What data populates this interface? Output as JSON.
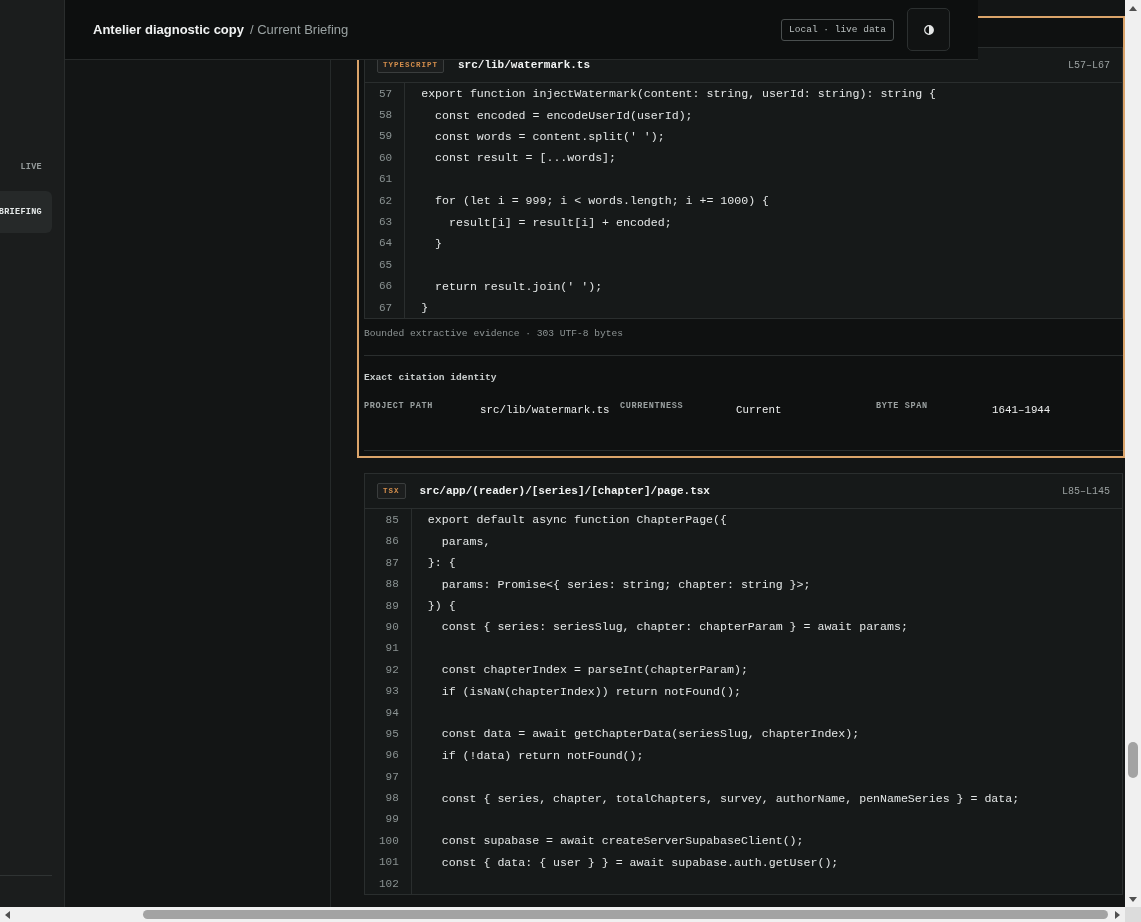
{
  "sidebar": {
    "items": [
      {
        "label": "LIVE",
        "selected": false
      },
      {
        "label": "BRIEFING",
        "selected": true
      }
    ]
  },
  "top_bar": {
    "title": "Antelier diagnostic copy",
    "breadcrumb": "/ Current Briefing",
    "source_tag": "Local · live data"
  },
  "evidence": [
    {
      "selected": true,
      "language": "TYPESCRIPT",
      "path": "src/lib/watermark.ts",
      "range": "L57–L67",
      "lines": [
        {
          "number": "57",
          "code": "export function injectWatermark(content: string, userId: string): string {"
        },
        {
          "number": "58",
          "code": "  const encoded = encodeUserId(userId);"
        },
        {
          "number": "59",
          "code": "  const words = content.split(' ');"
        },
        {
          "number": "60",
          "code": "  const result = [...words];"
        },
        {
          "number": "61"
        },
        {
          "number": "62",
          "code": "  for (let i = 999; i < words.length; i += 1000) {"
        },
        {
          "number": "63",
          "code": "    result[i] = result[i] + encoded;"
        },
        {
          "number": "64",
          "code": "  }"
        },
        {
          "number": "65"
        },
        {
          "number": "66",
          "code": "  return result.join(' ');"
        },
        {
          "number": "67",
          "code": "}"
        }
      ],
      "note": "Bounded extractive evidence · 303 UTF-8 bytes",
      "citation": {
        "title": "Exact citation identity",
        "fields": [
          {
            "label": "PROJECT PATH",
            "value": "src/lib/watermark.ts"
          },
          {
            "label": "CURRENTNESS",
            "value": "Current"
          },
          {
            "label": "BYTE SPAN",
            "value": "1641–1944"
          }
        ]
      }
    },
    {
      "selected": false,
      "language": "TSX",
      "path": "src/app/(reader)/[series]/[chapter]/page.tsx",
      "range": "L85–L145",
      "lines": [
        {
          "number": "85",
          "code": "export default async function ChapterPage({"
        },
        {
          "number": "86",
          "code": "  params,"
        },
        {
          "number": "87",
          "code": "}: {"
        },
        {
          "number": "88",
          "code": "  params: Promise<{ series: string; chapter: string }>;"
        },
        {
          "number": "89",
          "code": "}) {"
        },
        {
          "number": "90",
          "code": "  const { series: seriesSlug, chapter: chapterParam } = await params;"
        },
        {
          "number": "91"
        },
        {
          "number": "92",
          "code": "  const chapterIndex = parseInt(chapterParam);"
        },
        {
          "number": "93",
          "code": "  if (isNaN(chapterIndex)) return notFound();"
        },
        {
          "number": "94"
        },
        {
          "number": "95",
          "code": "  const data = await getChapterData(seriesSlug, chapterIndex);"
        },
        {
          "number": "96",
          "code": "  if (!data) return notFound();"
        },
        {
          "number": "97"
        },
        {
          "number": "98",
          "code": "  const { series, chapter, totalChapters, survey, authorName, penNameSeries } = data;"
        },
        {
          "number": "99"
        },
        {
          "number": "100",
          "code": "  const supabase = await createServerSupabaseClient();"
        },
        {
          "number": "101",
          "code": "  const { data: { user } } = await supabase.auth.getUser();"
        },
        {
          "number": "102"
        }
      ]
    }
  ]
}
